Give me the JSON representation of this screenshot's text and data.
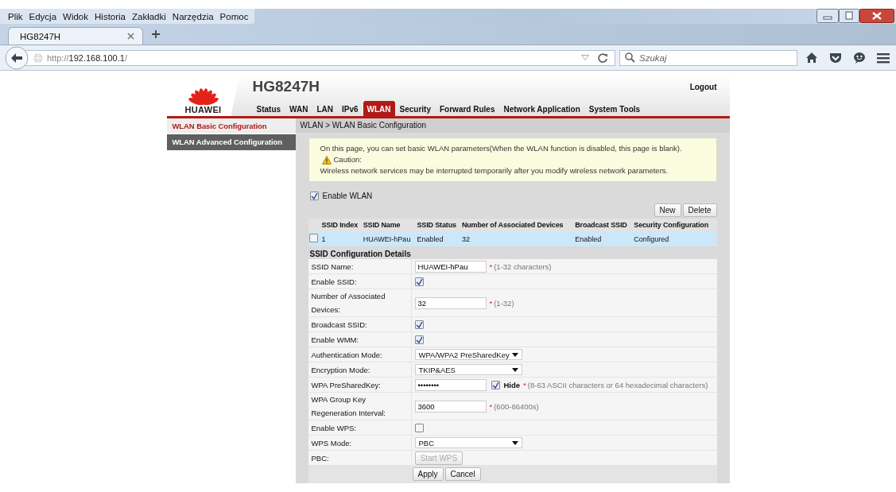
{
  "browser": {
    "menu": [
      "Plik",
      "Edycja",
      "Widok",
      "Historia",
      "Zakładki",
      "Narzędzia",
      "Pomoc"
    ],
    "tabs": [
      {
        "title": "HG8247H",
        "selected": true
      }
    ],
    "url_scheme": "http://",
    "url_host": "192.168.100.1",
    "url_path": "/",
    "search_placeholder": "Szukaj"
  },
  "router": {
    "brand": "HUAWEI",
    "model": "HG8247H",
    "logout": "Logout",
    "nav": [
      {
        "label": "Status",
        "selected": false
      },
      {
        "label": "WAN",
        "selected": false
      },
      {
        "label": "LAN",
        "selected": false
      },
      {
        "label": "IPv6",
        "selected": false
      },
      {
        "label": "WLAN",
        "selected": true
      },
      {
        "label": "Security",
        "selected": false
      },
      {
        "label": "Forward Rules",
        "selected": false
      },
      {
        "label": "Network Application",
        "selected": false
      },
      {
        "label": "System Tools",
        "selected": false
      }
    ],
    "sidebar": [
      {
        "label": "WLAN Basic Configuration",
        "selected": true
      },
      {
        "label": "WLAN Advanced Configuration",
        "selected": false
      }
    ],
    "breadcrumb": "WLAN > WLAN Basic Configuration",
    "notice": {
      "intro": "On this page, you can set basic WLAN parameters(When the WLAN function is disabled, this page is blank).",
      "caution": "Caution:",
      "warning": "Wireless network services may be interrupted temporarily after you modify wireless network parameters."
    },
    "enable_wlan": {
      "label": "Enable WLAN",
      "checked": true
    },
    "table_buttons": [
      "New",
      "Delete"
    ],
    "table": {
      "columns": [
        "SSID Index",
        "SSID Name",
        "SSID Status",
        "Number of Associated Devices",
        "Broadcast SSID",
        "Security Configuration"
      ],
      "rows": [
        {
          "checked": false,
          "selected": true,
          "cells": [
            "1",
            "HUAWEI-hPau",
            "Enabled",
            "32",
            "Enabled",
            "Configured"
          ]
        }
      ]
    },
    "details": {
      "title": "SSID Configuration Details",
      "rows": [
        {
          "kind": "text",
          "label": "SSID Name:",
          "value": "HUAWEI-hPau",
          "mark": "*",
          "hint": " (1-32 characters)"
        },
        {
          "kind": "checkbox",
          "label": "Enable SSID:",
          "checked": true
        },
        {
          "kind": "text",
          "label": "Number of Associated Devices:",
          "value": "32",
          "mark": "*",
          "hint": " (1-32)"
        },
        {
          "kind": "checkbox",
          "label": "Broadcast SSID:",
          "checked": true
        },
        {
          "kind": "checkbox",
          "label": "Enable WMM:",
          "checked": true
        },
        {
          "kind": "select",
          "label": "Authentication Mode:",
          "value": "WPA/WPA2 PreSharedKey"
        },
        {
          "kind": "select",
          "label": "Encryption Mode:",
          "value": "TKIP&AES"
        },
        {
          "kind": "password",
          "label": "WPA PreSharedKey:",
          "value": "••••••••",
          "hide_label": "Hide",
          "checked": true,
          "mark": "*",
          "hint": "(8-63 ASCII characters or 64 hexadecimal characters)"
        },
        {
          "kind": "text",
          "label": "WPA Group Key Regeneration Interval:",
          "value": "3600",
          "mark": "*",
          "hint": "(600-86400s)"
        },
        {
          "kind": "checkbox",
          "label": "Enable WPS:",
          "checked": false
        },
        {
          "kind": "select",
          "label": "WPS Mode:",
          "value": "PBC"
        },
        {
          "kind": "button",
          "label": "PBC:",
          "value": "Start WPS",
          "disabled": true
        }
      ]
    },
    "actions": [
      "Apply",
      "Cancel"
    ]
  }
}
